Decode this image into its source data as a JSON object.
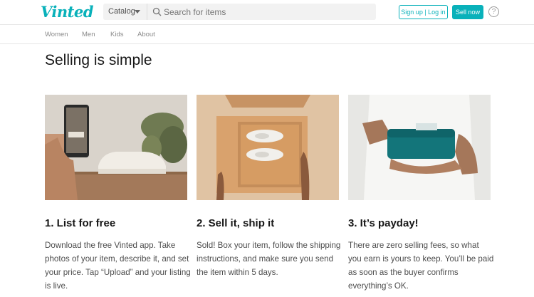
{
  "header": {
    "logo": "Vinted",
    "catalog_label": "Catalog",
    "search_placeholder": "Search for items",
    "signup_label": "Sign up | Log in",
    "sellnow_label": "Sell now",
    "help_label": "?"
  },
  "nav": {
    "items": [
      "Women",
      "Men",
      "Kids",
      "About"
    ]
  },
  "main": {
    "title": "Selling is simple",
    "cards": [
      {
        "title": "1. List for free",
        "text": "Download the free Vinted app. Take photos of your item, describe it, and set your price. Tap “Upload” and your listing is live."
      },
      {
        "title": "2. Sell it, ship it",
        "text": "Sold! Box your item, follow the shipping instructions, and make sure you send the item within 5 days."
      },
      {
        "title": "3. It’s payday!",
        "text": "There are zero selling fees, so what you earn is yours to keep. You’ll be paid as soon as the buyer confirms everything’s OK."
      }
    ]
  },
  "colors": {
    "brand": "#09b1ba",
    "text": "#171717",
    "muted": "#4d4d4d"
  }
}
